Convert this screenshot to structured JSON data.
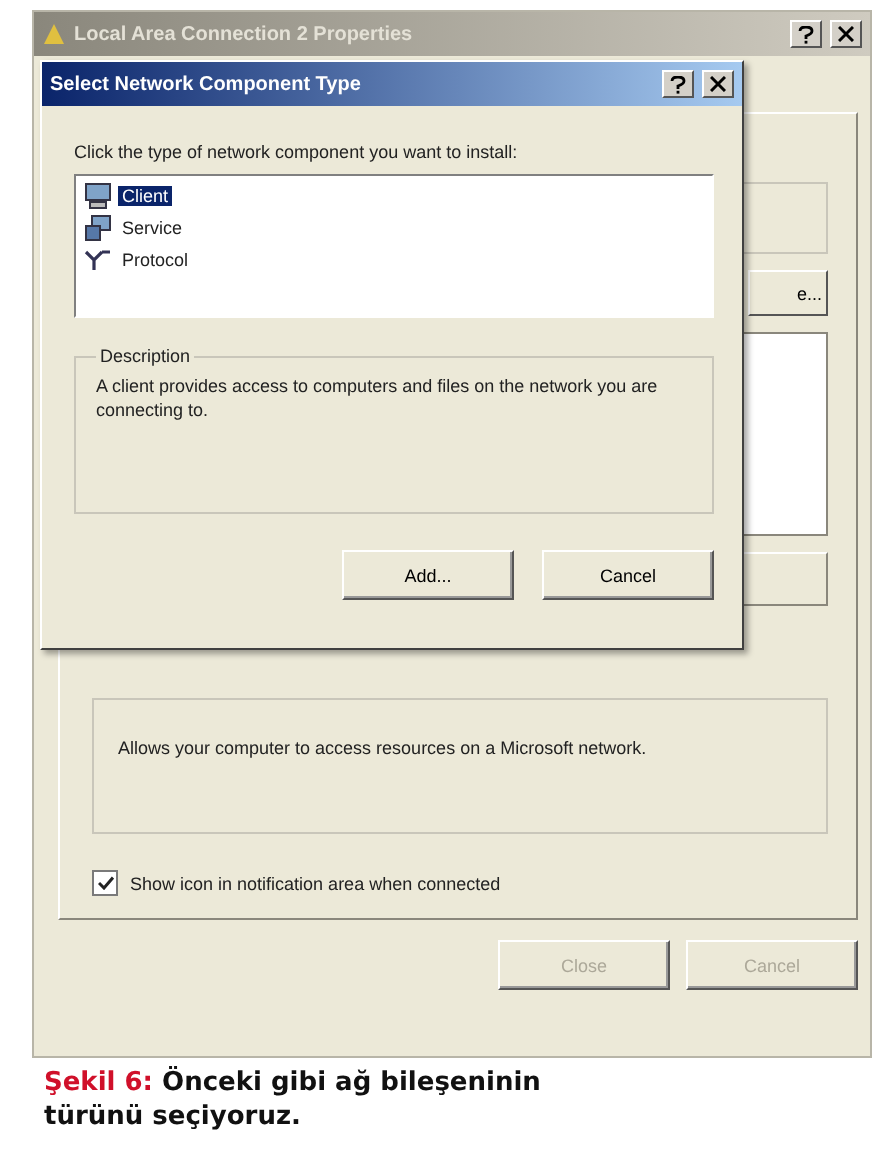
{
  "parent_window": {
    "title": "Local Area Connection 2 Properties",
    "active": false,
    "partial_button": "e...",
    "description": "Allows your computer to access resources on a Microsoft network.",
    "checkbox": {
      "label": "Show icon in notification area when connected",
      "checked": true
    },
    "buttons": [
      {
        "label": "Close",
        "disabled": true
      },
      {
        "label": "Cancel",
        "disabled": true
      }
    ]
  },
  "dialog": {
    "title": "Select Network Component Type",
    "active": true,
    "prompt": "Click the type of network component you want to install:",
    "items": [
      {
        "label": "Client",
        "kind": "client",
        "selected": true
      },
      {
        "label": "Service",
        "kind": "service",
        "selected": false
      },
      {
        "label": "Protocol",
        "kind": "protocol",
        "selected": false
      }
    ],
    "description_title": "Description",
    "description": "A client provides access to computers and files on the network you are connecting to.",
    "buttons": [
      {
        "label": "Add...",
        "disabled": false
      },
      {
        "label": "Cancel",
        "disabled": false
      }
    ]
  },
  "caption": {
    "label": "Şekil 6:",
    "text": "Önceki gibi ağ bileşeninin türünü seçiyoruz."
  }
}
